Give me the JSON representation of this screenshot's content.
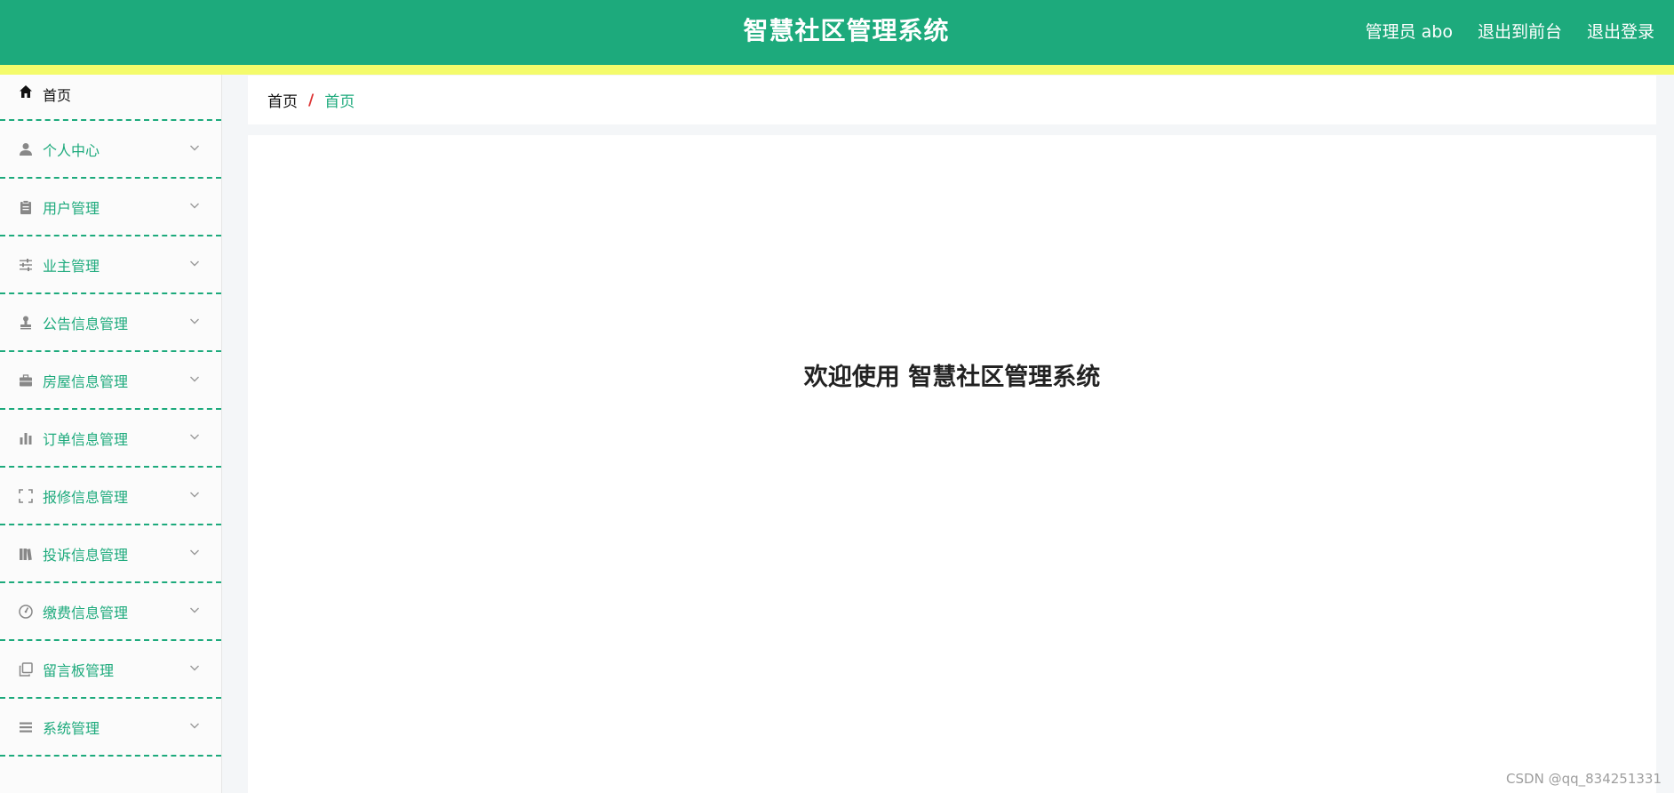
{
  "header": {
    "title": "智慧社区管理系统",
    "user_label": "管理员 abo",
    "front_link": "退出到前台",
    "logout_link": "退出登录",
    "bg_color": "#1daa7c",
    "stripe_color": "#f4fb6b"
  },
  "sidebar": {
    "accent_color": "#1daa7c",
    "items": [
      {
        "label": "首页",
        "icon": "home-icon"
      },
      {
        "label": "个人中心",
        "icon": "user-icon"
      },
      {
        "label": "用户管理",
        "icon": "clipboard-icon"
      },
      {
        "label": "业主管理",
        "icon": "sliders-icon"
      },
      {
        "label": "公告信息管理",
        "icon": "stamp-icon"
      },
      {
        "label": "房屋信息管理",
        "icon": "briefcase-icon"
      },
      {
        "label": "订单信息管理",
        "icon": "bar-chart-icon"
      },
      {
        "label": "报修信息管理",
        "icon": "fullscreen-icon"
      },
      {
        "label": "投诉信息管理",
        "icon": "books-icon"
      },
      {
        "label": "缴费信息管理",
        "icon": "gauge-icon"
      },
      {
        "label": "留言板管理",
        "icon": "copy-icon"
      },
      {
        "label": "系统管理",
        "icon": "menu-icon"
      }
    ]
  },
  "breadcrumb": {
    "root": "首页",
    "separator": "/",
    "current": "首页"
  },
  "main": {
    "welcome": "欢迎使用 智慧社区管理系统"
  },
  "watermark": "CSDN @qq_834251331"
}
